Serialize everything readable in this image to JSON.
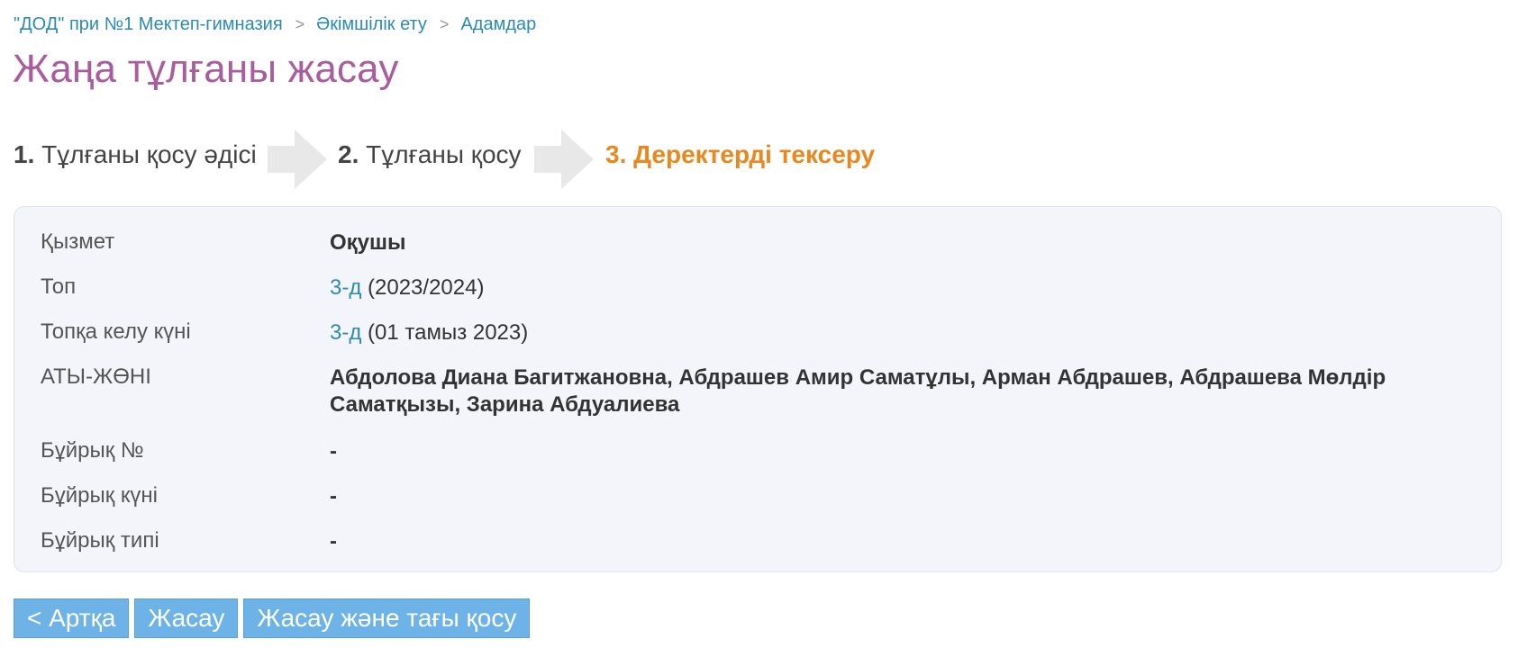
{
  "breadcrumb": {
    "items": [
      "\"ДОД\" при №1 Мектеп-гимназия",
      "Әкімшілік ету",
      "Адамдар"
    ],
    "separator": ">"
  },
  "page": {
    "title": "Жаңа тұлғаны жасау"
  },
  "steps": [
    {
      "num": "1.",
      "label": "Тұлғаны қосу әдісі",
      "active": false
    },
    {
      "num": "2.",
      "label": "Тұлғаны қосу",
      "active": false
    },
    {
      "num": "3.",
      "label": "Деректерді тексеру",
      "active": true
    }
  ],
  "details": {
    "position": {
      "label": "Қызмет",
      "value": "Оқушы"
    },
    "group": {
      "label": "Топ",
      "link": "3-д",
      "suffix": "(2023/2024)"
    },
    "join_date": {
      "label": "Топқа келу күні",
      "link": "3-д",
      "suffix": "(01 тамыз 2023)"
    },
    "names": {
      "label": "АТЫ-ЖӨНІ",
      "value": "Абдолова Диана Багитжановна, Абдрашев Амир Саматұлы, Арман Абдрашев, Абдрашева Мөлдір Саматқызы, Зарина Абдуалиева"
    },
    "order_no": {
      "label": "Бұйрық №",
      "value": "-"
    },
    "order_date": {
      "label": "Бұйрық күні",
      "value": "-"
    },
    "order_type": {
      "label": "Бұйрық типі",
      "value": "-"
    }
  },
  "buttons": {
    "back": "< Артқа",
    "create": "Жасау",
    "create_and_add": "Жасау және тағы қосу"
  },
  "colors": {
    "link": "#2a8ab8",
    "title": "#a95d9c",
    "active_step": "#e8881f",
    "button": "#6db3e8",
    "panel": "#f3f5fb"
  }
}
